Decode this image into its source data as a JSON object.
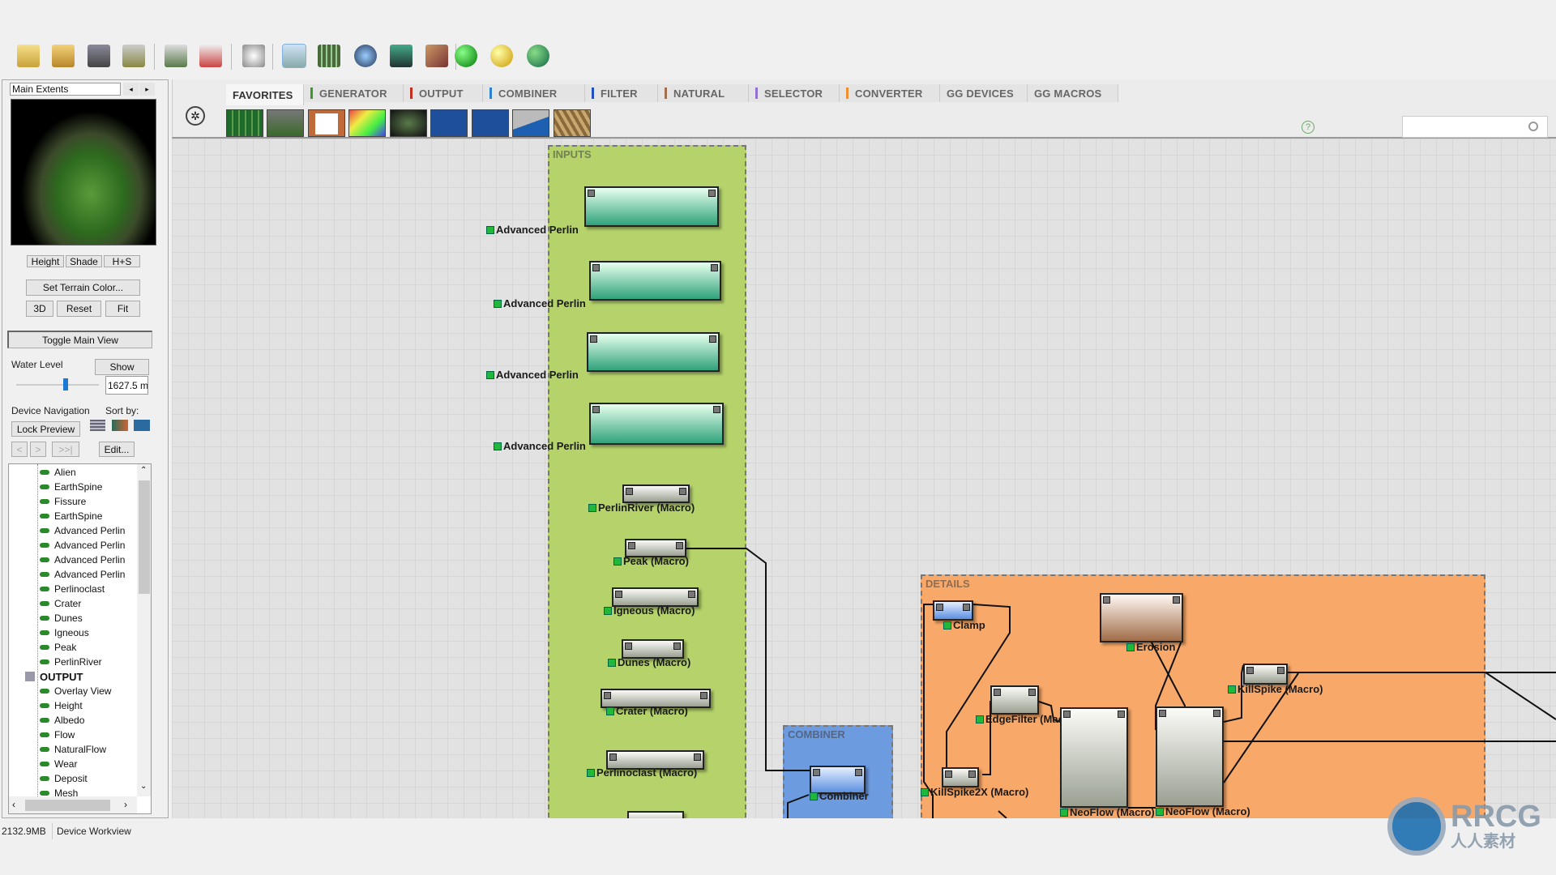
{
  "toolbar": {
    "icons": [
      "new-project-icon",
      "open-icon",
      "save-icon",
      "export-icon",
      "build-icon",
      "script-icon",
      "randomize-icon",
      "device-workview-icon",
      "grid-view-icon",
      "globe-icon",
      "terrain-icon",
      "texture-icon",
      "green-sphere-icon",
      "yellow-sphere-icon",
      "green-globe-icon"
    ],
    "active_index": 7
  },
  "preview": {
    "extents": "Main Extents",
    "prev": "◂",
    "next": "▸",
    "height": "Height",
    "shade": "Shade",
    "hs": "H+S",
    "set_color": "Set Terrain Color...",
    "b3d": "3D",
    "reset": "Reset",
    "fit": "Fit",
    "toggle": "Toggle Main View"
  },
  "water": {
    "label": "Water Level",
    "show": "Show",
    "value": "1627.5 m",
    "slider_fraction": 0.55
  },
  "nav": {
    "label": "Device Navigation",
    "sort": "Sort by:",
    "lock": "Lock Preview",
    "back": "<",
    "fwd": ">",
    "end": ">>|",
    "edit": "Edit..."
  },
  "tree": {
    "items": [
      "Alien",
      "EarthSpine",
      "Fissure",
      "EarthSpine",
      "Advanced Perlin",
      "Advanced Perlin",
      "Advanced Perlin",
      "Advanced Perlin",
      "Perlinoclast",
      "Crater",
      "Dunes",
      "Igneous",
      "Peak",
      "PerlinRiver"
    ],
    "group": "OUTPUT",
    "output_items": [
      "Overlay View",
      "Height",
      "Albedo",
      "Flow",
      "NaturalFlow",
      "Wear",
      "Deposit",
      "Mesh"
    ]
  },
  "status": {
    "memory": "2132.9MB",
    "view": "Device Workview"
  },
  "tabs": [
    {
      "label": "FAVORITES",
      "color": ""
    },
    {
      "label": "GENERATOR",
      "color": "#3a9a2a"
    },
    {
      "label": "OUTPUT",
      "color": "#c03020"
    },
    {
      "label": "COMBINER",
      "color": "#3080d0"
    },
    {
      "label": "FILTER",
      "color": "#2050c0"
    },
    {
      "label": "NATURAL",
      "color": "#a07050"
    },
    {
      "label": "SELECTOR",
      "color": "#9070d0"
    },
    {
      "label": "CONVERTER",
      "color": "#f09030"
    },
    {
      "label": "GG DEVICES",
      "color": ""
    },
    {
      "label": "GG MACROS",
      "color": ""
    }
  ],
  "help": "?",
  "groups": {
    "inputs": "INPUTS",
    "combiner": "COMBINER",
    "details": "DETAILS"
  },
  "nodes": {
    "ap1": "Advanced Perlin",
    "ap2": "Advanced Perlin",
    "ap3": "Advanced Perlin",
    "ap4": "Advanced Perlin",
    "perlinriver": "PerlinRiver (Macro)",
    "peak": "Peak (Macro)",
    "igneous": "Igneous (Macro)",
    "dunes": "Dunes (Macro)",
    "crater": "Crater (Macro)",
    "perlinoclast": "Perlinoclast (Macro)",
    "combiner": "Combiner",
    "clamp": "Clamp",
    "erosion": "Erosion",
    "edgefilter": "EdgeFilter (Macro)",
    "killspike2x": "KillSpike2X (Macro)",
    "neoflow1": "NeoFlow (Macro)",
    "neoflow2": "NeoFlow (Macro)",
    "killspike": "KillSpike (Macro)"
  },
  "watermark": {
    "text": "RRCG",
    "sub": "人人素材"
  }
}
